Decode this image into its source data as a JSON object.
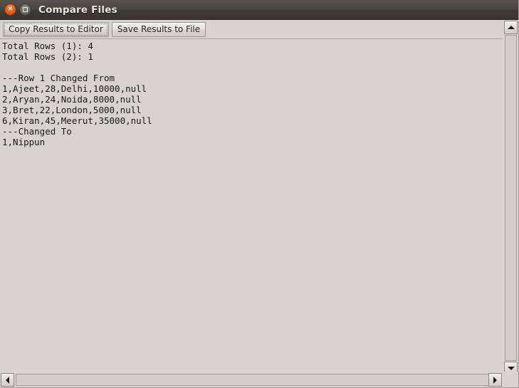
{
  "window": {
    "title": "Compare Files",
    "controls": [
      {
        "name": "close-button",
        "icon": "close-icon",
        "glyph": "✕"
      },
      {
        "name": "maximize-button",
        "icon": "maximize-icon",
        "glyph": ""
      }
    ]
  },
  "toolbar": {
    "copy_results_label": "Copy Results to Editor",
    "save_results_label": "Save Results to File"
  },
  "results": {
    "text": "Total Rows (1): 4\nTotal Rows (2): 1\n\n---Row 1 Changed From\n1,Ajeet,28,Delhi,10000,null\n2,Aryan,24,Noida,8000,null\n3,Bret,22,London,5000,null\n6,Kiran,45,Meerut,35000,null\n---Changed To\n1,Nippun",
    "lines": [
      "Total Rows (1): 4",
      "Total Rows (2): 1",
      "",
      "---Row 1 Changed From",
      "1,Ajeet,28,Delhi,10000,null",
      "2,Aryan,24,Noida,8000,null",
      "3,Bret,22,London,5000,null",
      "6,Kiran,45,Meerut,35000,null",
      "---Changed To",
      "1,Nippun"
    ],
    "summary": {
      "total_rows_1": 4,
      "total_rows_2": 1
    }
  },
  "scrollbars": {
    "vertical": {
      "up_icon": "arrow-up-icon",
      "down_icon": "arrow-down-icon"
    },
    "horizontal": {
      "left_icon": "arrow-left-icon",
      "right_icon": "arrow-right-icon"
    }
  },
  "colors": {
    "titlebar": "#4a4743",
    "close_button": "#e35c18",
    "content_background": "#d6d3d1",
    "text": "#1b1917"
  }
}
